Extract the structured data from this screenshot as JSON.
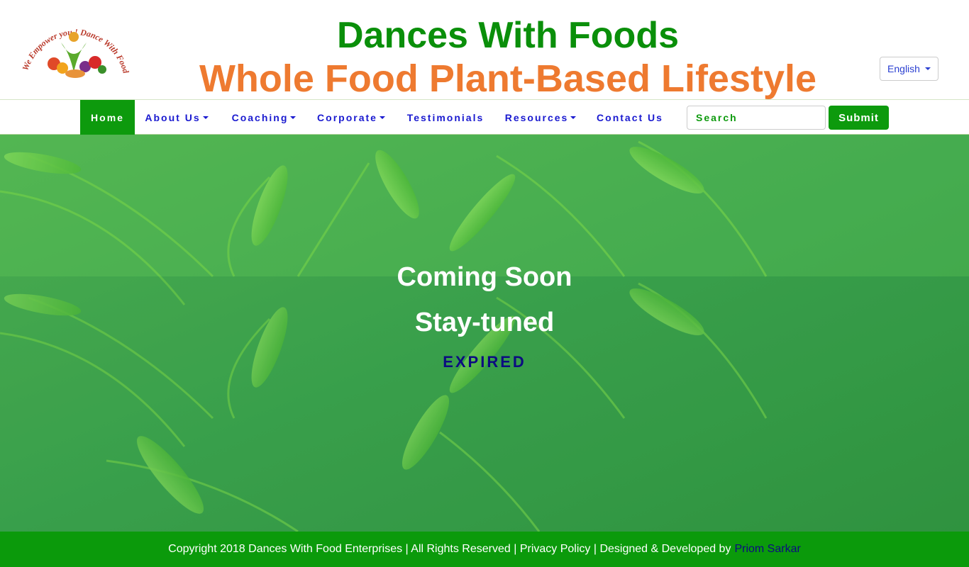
{
  "header": {
    "logo_text": "We Empower you ! Dance With Foods",
    "title": "Dances With Foods",
    "subtitle": "Whole Food Plant-Based Lifestyle",
    "language": "English"
  },
  "nav": {
    "items": [
      {
        "label": "Home",
        "active": true
      },
      {
        "label": "About Us",
        "dropdown": true
      },
      {
        "label": "Coaching ",
        "dropdown": true
      },
      {
        "label": "Corporate",
        "dropdown": true
      },
      {
        "label": "Testimonials"
      },
      {
        "label": "Resources",
        "dropdown": true
      },
      {
        "label": "Contact Us"
      }
    ],
    "search_placeholder": "Search",
    "submit_label": "Submit"
  },
  "hero": {
    "heading": "Coming Soon",
    "subheading": "Stay-tuned",
    "status": "EXPIRED"
  },
  "footer": {
    "text": "Copyright 2018 Dances With Food Enterprises | All Rights Reserved | Privacy Policy | Designed & Developed by",
    "developer": "Priom Sarkar"
  },
  "colors": {
    "brand_green": "#0d9a0d",
    "brand_orange": "#ee7a30",
    "link_blue": "#1a1ad0"
  }
}
